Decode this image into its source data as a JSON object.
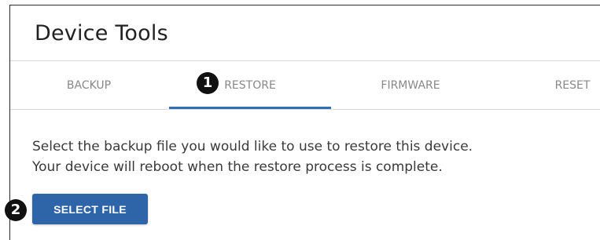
{
  "page": {
    "title": "Device Tools"
  },
  "tabs": [
    {
      "label": "BACKUP",
      "active": false
    },
    {
      "label": "RESTORE",
      "active": true
    },
    {
      "label": "FIRMWARE",
      "active": false
    },
    {
      "label": "RESET",
      "active": false
    }
  ],
  "restore": {
    "line1": "Select the backup file you would like to use to restore this device.",
    "line2": "Your device will reboot when the restore process is complete.",
    "select_button_label": "SELECT FILE"
  },
  "callouts": {
    "first": "1",
    "second": "2"
  },
  "colors": {
    "accent": "#2e64a8",
    "tab_underline": "#2f6fb3",
    "tab_text": "#888888"
  }
}
